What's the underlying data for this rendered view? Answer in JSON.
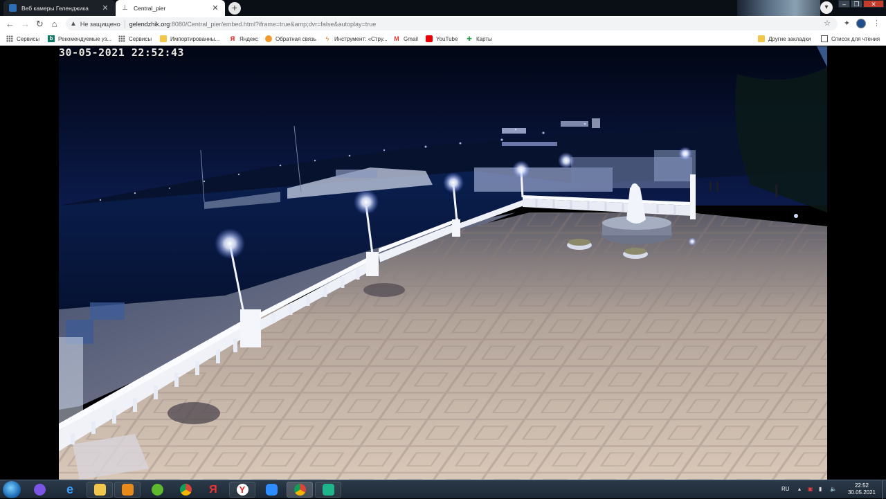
{
  "tabs": [
    {
      "title": "Веб камеры Геленджика",
      "active": false
    },
    {
      "title": "Central_pier",
      "active": true
    }
  ],
  "toolbar": {
    "security_label": "Не защищено",
    "url_host": "gelendzhik.org",
    "url_rest": ":8080/Central_pier/embed.html?iframe=true&amp;dvr=false&autoplay=true"
  },
  "bookmarks": [
    {
      "label": "Сервисы",
      "icon": "grid-icon"
    },
    {
      "label": "Рекомендуемые уз...",
      "icon": "bing-icon"
    },
    {
      "label": "Сервисы",
      "icon": "grid-icon"
    },
    {
      "label": "Импортированны...",
      "icon": "folder-icon"
    },
    {
      "label": "Яндекс",
      "icon": "yandex-icon"
    },
    {
      "label": "Обратная связь",
      "icon": "feedback-icon"
    },
    {
      "label": "Инструмент: «Стру...",
      "icon": "tool-icon"
    },
    {
      "label": "Gmail",
      "icon": "gmail-icon"
    },
    {
      "label": "YouTube",
      "icon": "youtube-icon"
    },
    {
      "label": "Карты",
      "icon": "maps-icon"
    }
  ],
  "bookmarks_right": [
    {
      "label": "Другие закладки",
      "icon": "folder-icon"
    },
    {
      "label": "Список для чтения",
      "icon": "reading-list-icon"
    }
  ],
  "camera": {
    "timestamp": "30-05-2021 22:52:43"
  },
  "taskbar": {
    "apps": [
      "alice-icon",
      "internet-explorer-icon",
      "file-explorer-icon",
      "media-player-icon",
      "utorrent-icon",
      "chrome-icon",
      "yandex-icon",
      "yandex-browser-icon",
      "zoom-icon",
      "chrome-active-icon",
      "app-icon"
    ],
    "lang": "RU",
    "time": "22:52",
    "date": "30.05.2021"
  },
  "colors": {
    "chrome_dark": "#0a0f15",
    "toolbar_bg": "#ffffff",
    "taskbar": "#1c2734"
  }
}
